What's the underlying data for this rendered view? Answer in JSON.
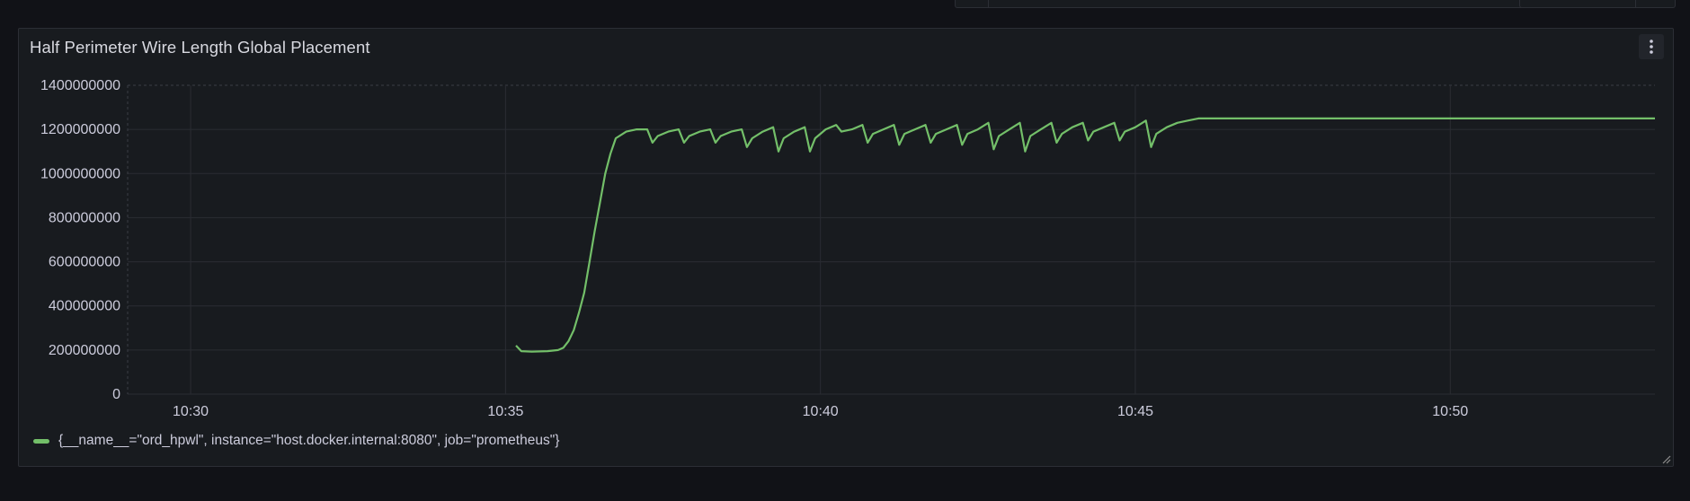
{
  "panel": {
    "title": "Half Perimeter Wire Length Global Placement",
    "menu_icon": "kebab-menu-icon"
  },
  "colors": {
    "background": "#111217",
    "panel_bg": "#181b1f",
    "grid": "#2a2c33",
    "series": "#73bf69",
    "text": "#ccccdc"
  },
  "chart_data": {
    "type": "line",
    "title": "Half Perimeter Wire Length Global Placement",
    "xlabel": "",
    "ylabel": "",
    "ylim": [
      0,
      1400000000
    ],
    "xlim": [
      "10:29",
      "10:53:15"
    ],
    "y_ticks": [
      "0",
      "200000000",
      "400000000",
      "600000000",
      "800000000",
      "1000000000",
      "1200000000",
      "1400000000"
    ],
    "y_tick_values": [
      0,
      200000000,
      400000000,
      600000000,
      800000000,
      1000000000,
      1200000000,
      1400000000
    ],
    "x_ticks": [
      "10:30",
      "10:35",
      "10:40",
      "10:45",
      "10:50"
    ],
    "grid": true,
    "legend_position": "bottom-left",
    "series": [
      {
        "name": "{__name__=\"ord_hpwl\", instance=\"host.docker.internal:8080\", job=\"prometheus\"}",
        "color": "#73bf69",
        "points": [
          [
            "10:35:10",
            220000000
          ],
          [
            "10:35:15",
            195000000
          ],
          [
            "10:35:25",
            193000000
          ],
          [
            "10:35:40",
            195000000
          ],
          [
            "10:35:50",
            200000000
          ],
          [
            "10:35:55",
            210000000
          ],
          [
            "10:36:00",
            240000000
          ],
          [
            "10:36:05",
            290000000
          ],
          [
            "10:36:10",
            370000000
          ],
          [
            "10:36:15",
            460000000
          ],
          [
            "10:36:20",
            600000000
          ],
          [
            "10:36:25",
            740000000
          ],
          [
            "10:36:30",
            870000000
          ],
          [
            "10:36:35",
            1000000000
          ],
          [
            "10:36:40",
            1090000000
          ],
          [
            "10:36:45",
            1160000000
          ],
          [
            "10:36:55",
            1190000000
          ],
          [
            "10:37:05",
            1200000000
          ],
          [
            "10:37:15",
            1200000000
          ],
          [
            "10:37:20",
            1140000000
          ],
          [
            "10:37:25",
            1170000000
          ],
          [
            "10:37:35",
            1190000000
          ],
          [
            "10:37:45",
            1200000000
          ],
          [
            "10:37:50",
            1140000000
          ],
          [
            "10:37:55",
            1170000000
          ],
          [
            "10:38:05",
            1190000000
          ],
          [
            "10:38:15",
            1200000000
          ],
          [
            "10:38:20",
            1140000000
          ],
          [
            "10:38:25",
            1170000000
          ],
          [
            "10:38:35",
            1190000000
          ],
          [
            "10:38:45",
            1200000000
          ],
          [
            "10:38:50",
            1120000000
          ],
          [
            "10:38:55",
            1160000000
          ],
          [
            "10:39:05",
            1190000000
          ],
          [
            "10:39:15",
            1210000000
          ],
          [
            "10:39:20",
            1100000000
          ],
          [
            "10:39:25",
            1160000000
          ],
          [
            "10:39:35",
            1190000000
          ],
          [
            "10:39:45",
            1210000000
          ],
          [
            "10:39:50",
            1100000000
          ],
          [
            "10:39:55",
            1160000000
          ],
          [
            "10:40:05",
            1200000000
          ],
          [
            "10:40:15",
            1220000000
          ],
          [
            "10:40:20",
            1190000000
          ],
          [
            "10:40:30",
            1200000000
          ],
          [
            "10:40:40",
            1220000000
          ],
          [
            "10:40:45",
            1140000000
          ],
          [
            "10:40:50",
            1180000000
          ],
          [
            "10:41:00",
            1200000000
          ],
          [
            "10:41:10",
            1220000000
          ],
          [
            "10:41:15",
            1130000000
          ],
          [
            "10:41:20",
            1180000000
          ],
          [
            "10:41:30",
            1200000000
          ],
          [
            "10:41:40",
            1220000000
          ],
          [
            "10:41:45",
            1140000000
          ],
          [
            "10:41:50",
            1180000000
          ],
          [
            "10:42:00",
            1200000000
          ],
          [
            "10:42:10",
            1220000000
          ],
          [
            "10:42:15",
            1130000000
          ],
          [
            "10:42:20",
            1180000000
          ],
          [
            "10:42:30",
            1200000000
          ],
          [
            "10:42:40",
            1230000000
          ],
          [
            "10:42:45",
            1110000000
          ],
          [
            "10:42:50",
            1170000000
          ],
          [
            "10:43:00",
            1200000000
          ],
          [
            "10:43:10",
            1230000000
          ],
          [
            "10:43:15",
            1100000000
          ],
          [
            "10:43:20",
            1170000000
          ],
          [
            "10:43:30",
            1200000000
          ],
          [
            "10:43:40",
            1230000000
          ],
          [
            "10:43:45",
            1140000000
          ],
          [
            "10:43:50",
            1180000000
          ],
          [
            "10:44:00",
            1210000000
          ],
          [
            "10:44:10",
            1230000000
          ],
          [
            "10:44:15",
            1150000000
          ],
          [
            "10:44:20",
            1190000000
          ],
          [
            "10:44:30",
            1210000000
          ],
          [
            "10:44:40",
            1230000000
          ],
          [
            "10:44:45",
            1150000000
          ],
          [
            "10:44:50",
            1190000000
          ],
          [
            "10:45:00",
            1210000000
          ],
          [
            "10:45:10",
            1240000000
          ],
          [
            "10:45:15",
            1120000000
          ],
          [
            "10:45:20",
            1180000000
          ],
          [
            "10:45:30",
            1210000000
          ],
          [
            "10:45:40",
            1230000000
          ],
          [
            "10:45:50",
            1240000000
          ],
          [
            "10:46:00",
            1250000000
          ],
          [
            "10:46:10",
            1250000000
          ],
          [
            "10:50:00",
            1250000000
          ],
          [
            "10:53:15",
            1250000000
          ]
        ]
      }
    ]
  }
}
